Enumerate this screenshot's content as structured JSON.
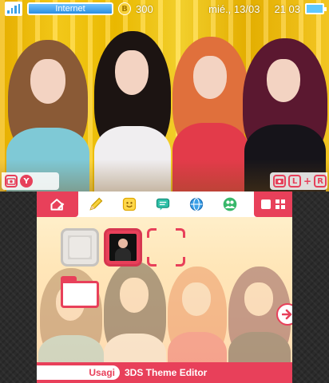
{
  "status_bar": {
    "connection_label": "Internet",
    "coin_symbol": "B",
    "play_coins": "300",
    "date": "mié., 13/03",
    "time": "21 03"
  },
  "top_controls": {
    "left_button_letter": "Y",
    "right_l_label": "L",
    "right_plus": "+",
    "right_r_label": "R"
  },
  "bottom_bar": {
    "author": "Usagi",
    "tool": "3DS Theme Editor"
  },
  "colors": {
    "accent": "#e8405a",
    "top_background": "#f6c200",
    "wifi_blue": "#2b8fe0"
  },
  "icons": {
    "toolbar": [
      "settings-edit-icon",
      "pencil-icon",
      "smiley-icon",
      "chat-icon",
      "globe-icon",
      "friends-icon",
      "home-menu-grid-icon"
    ]
  }
}
